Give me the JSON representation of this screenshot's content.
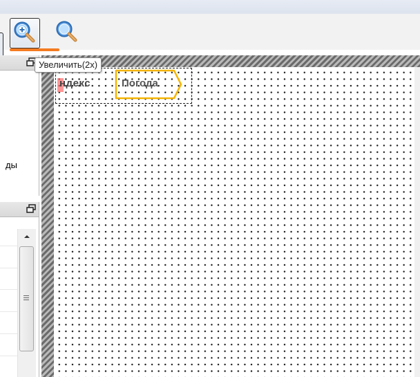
{
  "toolbar": {
    "zoom_in_button": {
      "icon": "zoom-in-icon",
      "active": true
    },
    "zoom_button": {
      "icon": "magnifier-icon"
    }
  },
  "tooltip": {
    "text": "Увеличить(2x)"
  },
  "left_panel_top": {
    "partial_label": "ды"
  },
  "canvas": {
    "widget_yandex_text": "ндекс",
    "widget_weather_text": "Погода"
  },
  "colors": {
    "accent_underline": "#f47b20",
    "weather_outline": "#f5b400",
    "yandex_red": "#ff6b6b"
  }
}
